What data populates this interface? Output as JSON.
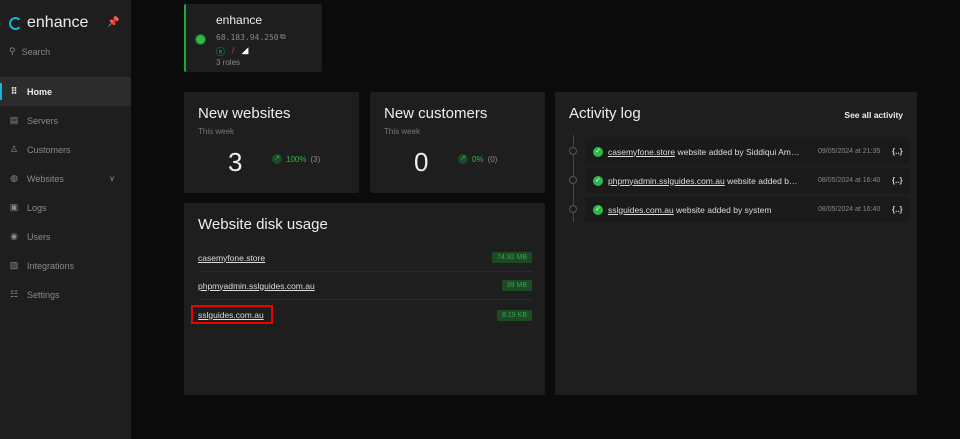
{
  "brand": {
    "name": "enhance",
    "accent": "#19b5d6"
  },
  "sidebar": {
    "search": "Search",
    "items": [
      {
        "label": "Home",
        "icon": "grid-icon",
        "active": true
      },
      {
        "label": "Servers",
        "icon": "server-icon"
      },
      {
        "label": "Customers",
        "icon": "user-icon"
      },
      {
        "label": "Websites",
        "icon": "globe-icon",
        "expandable": true
      },
      {
        "label": "Logs",
        "icon": "clipboard-icon"
      },
      {
        "label": "Users",
        "icon": "user-circle-icon"
      },
      {
        "label": "Integrations",
        "icon": "integrations-icon"
      },
      {
        "label": "Settings",
        "icon": "sliders-icon"
      }
    ]
  },
  "server": {
    "name": "enhance",
    "ip": "68.183.94.250",
    "roles": "3 roles",
    "status_color": "#2fb84a"
  },
  "new_websites": {
    "title": "New websites",
    "period": "This week",
    "value": "3",
    "change": "100%",
    "count": "(3)"
  },
  "new_customers": {
    "title": "New customers",
    "period": "This week",
    "value": "0",
    "change": "0%",
    "count": "(0)"
  },
  "disk_usage": {
    "title": "Website disk usage",
    "rows": [
      {
        "domain": "casemyfone.store",
        "size": "74.92 MB"
      },
      {
        "domain": "phpmyadmin.sslguides.com.au",
        "size": "39 MB"
      },
      {
        "domain": "sslguides.com.au",
        "size": "8.19 KB"
      }
    ]
  },
  "activity": {
    "title": "Activity log",
    "see_all": "See all activity",
    "rows": [
      {
        "link": "casemyfone.store",
        "text": " website added by Siddiqui Amm...",
        "time": "09/05/2024 at 21:35",
        "more": "{..}"
      },
      {
        "link": "phpmyadmin.sslguides.com.au",
        "text": " website added by ...",
        "time": "08/05/2024 at 16:40",
        "more": "{..}"
      },
      {
        "link": "sslguides.com.au",
        "text": " website added by system",
        "time": "08/05/2024 at 16:40",
        "more": "{..}"
      }
    ]
  }
}
